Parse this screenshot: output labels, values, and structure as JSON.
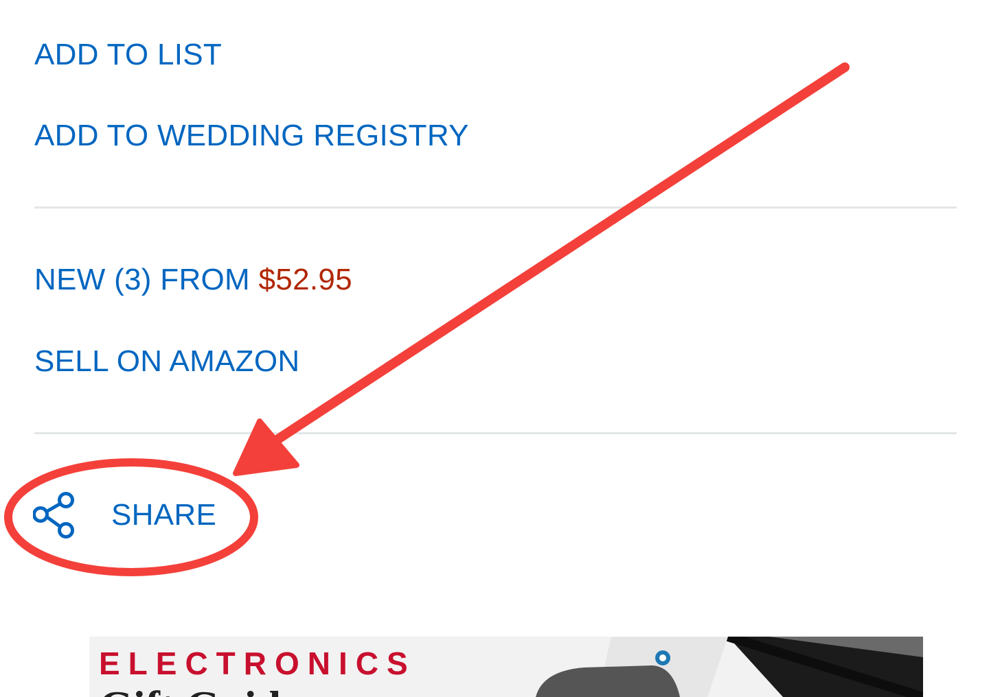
{
  "links": {
    "add_to_list": "ADD TO LIST",
    "add_to_registry": "ADD TO WEDDING REGISTRY",
    "new_offers_prefix": "NEW (3) FROM ",
    "new_offers_price": "$52.95",
    "sell_on_amazon": "SELL ON AMAZON"
  },
  "share": {
    "icon": "share-icon",
    "label": "SHARE"
  },
  "banner": {
    "title": "ELECTRONICS",
    "subtitle": "Gift Guide"
  },
  "annotation": {
    "type": "arrow-and-circle",
    "color": "#f4403a",
    "target": "share"
  },
  "colors": {
    "link": "#0066c0",
    "price": "#b12704",
    "divider": "#e3e6e6",
    "banner_title": "#c8102e"
  }
}
